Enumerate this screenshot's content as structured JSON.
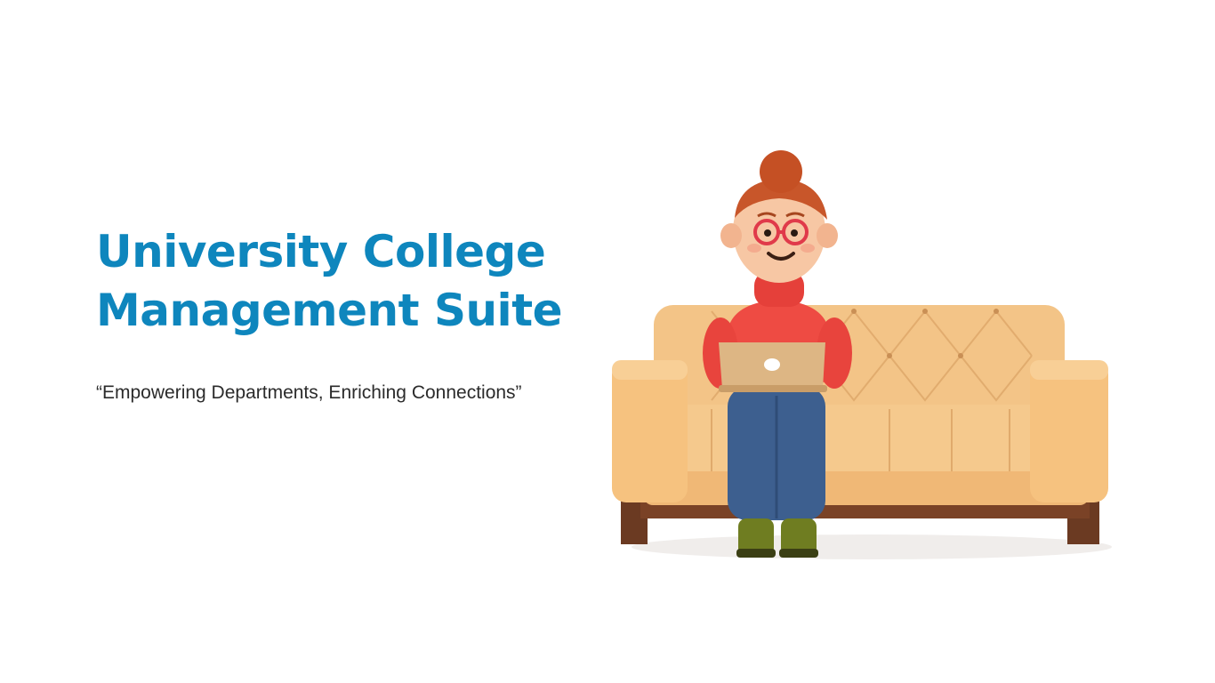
{
  "hero": {
    "title_line1": "University College",
    "title_line2": "Management Suite",
    "tagline": "“Empowering Departments, Enriching Connections”"
  },
  "illustration": {
    "icon": "person-on-sofa-with-laptop"
  },
  "colors": {
    "title": "#0e86bd",
    "tagline": "#2b2b2b",
    "background": "#ffffff"
  }
}
